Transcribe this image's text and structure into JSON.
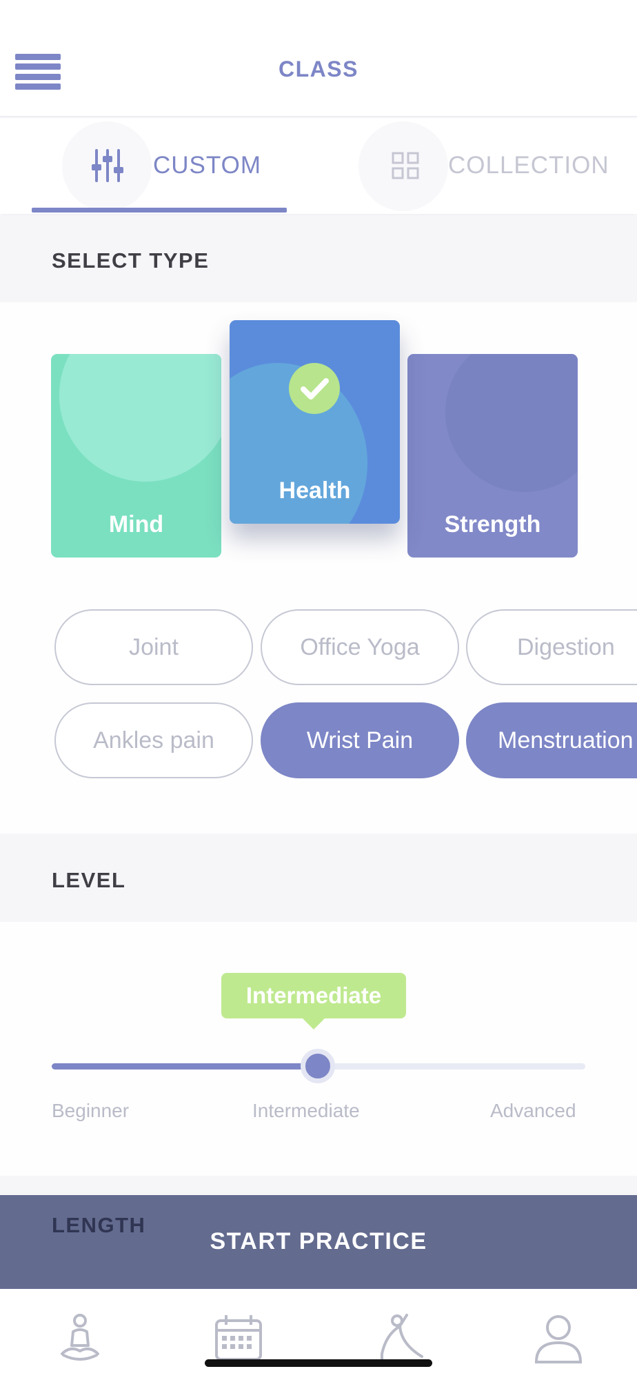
{
  "header": {
    "title": "CLASS",
    "menu_icon": "hamburger-menu-icon"
  },
  "tabs": [
    {
      "label": "CUSTOM",
      "icon": "sliders-icon",
      "active": true
    },
    {
      "label": "COLLECTION",
      "icon": "grid-icon",
      "active": false
    }
  ],
  "select_type": {
    "title": "SELECT TYPE",
    "cards": [
      {
        "label": "Mind",
        "selected": false,
        "color": "#7be0c0"
      },
      {
        "label": "Health",
        "selected": true,
        "color": "#5b8cdc"
      },
      {
        "label": "Strength",
        "selected": false,
        "color": "#8189c8"
      }
    ],
    "tags_row1": [
      {
        "label": "Joint",
        "selected": false
      },
      {
        "label": "Office Yoga",
        "selected": false
      },
      {
        "label": "Digestion",
        "selected": false
      }
    ],
    "tags_row2": [
      {
        "label": "Ankles pain",
        "selected": false
      },
      {
        "label": "Wrist Pain",
        "selected": true
      },
      {
        "label": "Menstruation",
        "selected": true
      }
    ]
  },
  "level": {
    "title": "LEVEL",
    "current": "Intermediate",
    "value_fraction": 0.5,
    "options": [
      "Beginner",
      "Intermediate",
      "Advanced"
    ]
  },
  "length": {
    "title": "LENGTH"
  },
  "start_button": {
    "label": "START PRACTICE"
  },
  "bottom_nav": [
    "meditation-icon",
    "calendar-icon",
    "yoga-pose-icon",
    "profile-icon"
  ],
  "colors": {
    "accent": "#7d86c6",
    "tooltip": "#bfe98f",
    "start_bar": "#636b8f",
    "check": "#b7e48c"
  }
}
